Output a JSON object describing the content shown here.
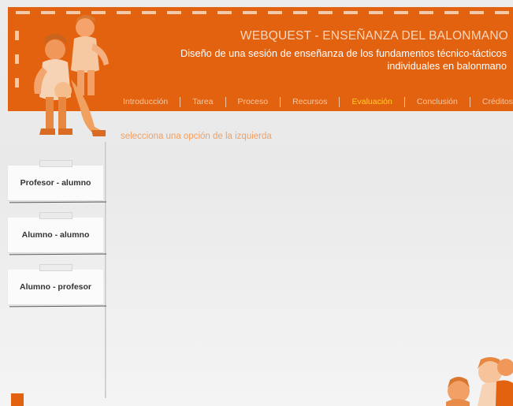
{
  "header": {
    "title": "WEBQUEST - ENSEÑANZA DEL BALONMANO",
    "subtitle": "Diseño de una sesión de enseñanza de los fundamentos técnico-tácticos individuales en balonmano"
  },
  "nav": {
    "items": [
      {
        "label": "Introducción"
      },
      {
        "label": "Tarea"
      },
      {
        "label": "Proceso"
      },
      {
        "label": "Recursos"
      },
      {
        "label": "Evaluación",
        "active": true
      },
      {
        "label": "Conclusión"
      },
      {
        "label": "Créditos"
      }
    ],
    "active_color": "#ffd21e"
  },
  "main": {
    "hint": "selecciona una opción de la izquierda"
  },
  "sidebar": {
    "items": [
      {
        "label": "Profesor - alumno"
      },
      {
        "label": "Alumno - alumno"
      },
      {
        "label": "Alumno - profesor"
      }
    ]
  },
  "colors": {
    "brand": "#e3620f",
    "hint": "#f2a062"
  }
}
